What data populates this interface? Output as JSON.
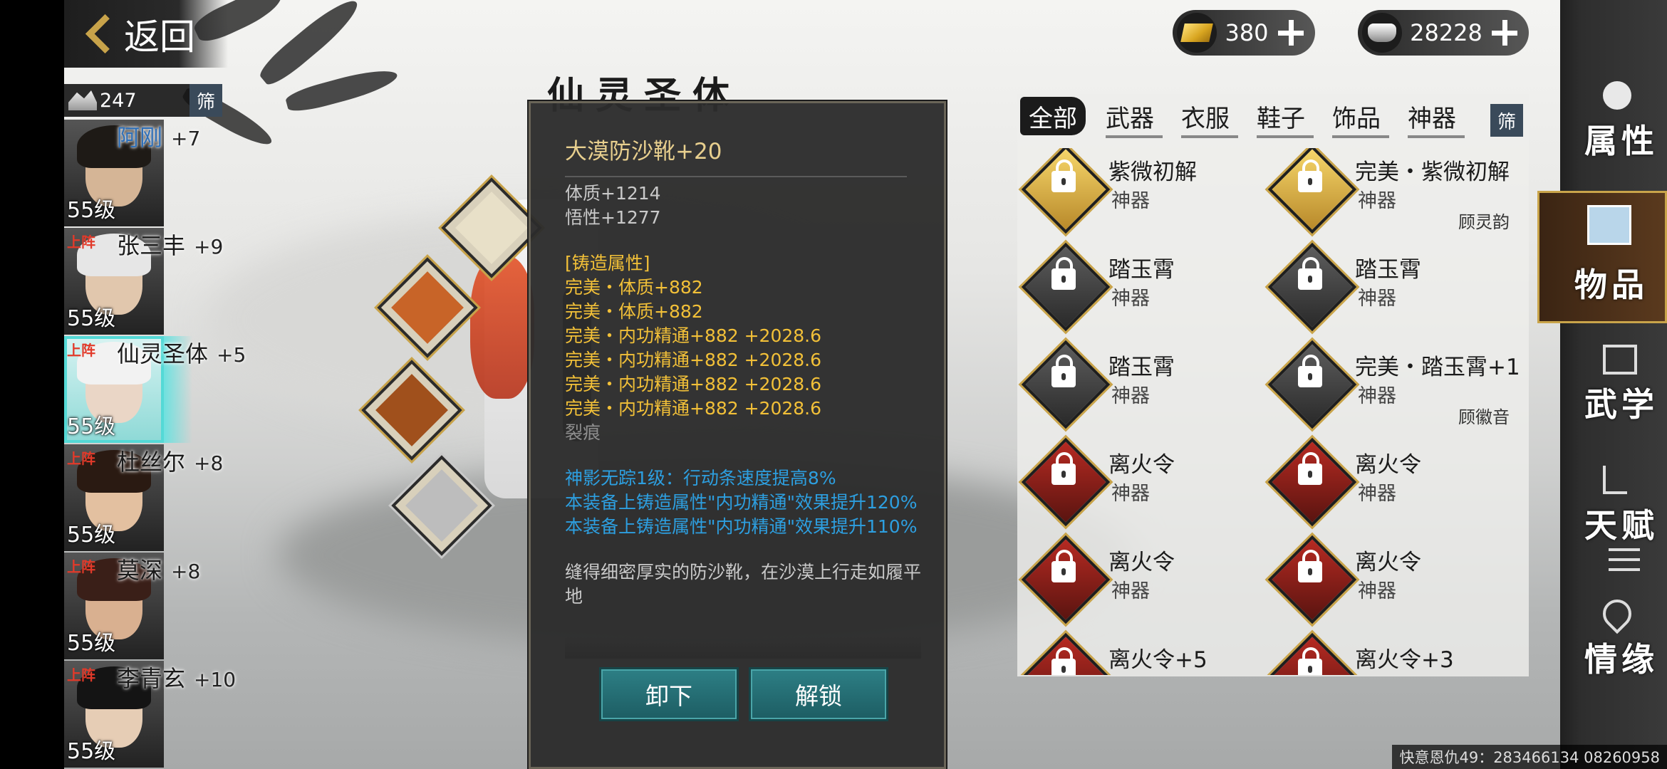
{
  "header": {
    "back_label": "返回",
    "gold": {
      "icon": "gold-ingot-icon",
      "value": "380"
    },
    "silver": {
      "icon": "silver-ingot-icon",
      "value": "28228"
    }
  },
  "roster": {
    "count": "247",
    "filter_label": "筛",
    "heroes": [
      {
        "name": "阿刚",
        "plus": "+7",
        "level": "55级",
        "tag": ""
      },
      {
        "name": "张三丰",
        "plus": "+9",
        "level": "55级",
        "tag": "上阵"
      },
      {
        "name": "仙灵圣体",
        "plus": "+5",
        "level": "55级",
        "tag": "上阵"
      },
      {
        "name": "杜丝尔",
        "plus": "+8",
        "level": "55级",
        "tag": "上阵"
      },
      {
        "name": "莫深",
        "plus": "+8",
        "level": "55级",
        "tag": "上阵"
      },
      {
        "name": "李青玄",
        "plus": "+10",
        "level": "55级",
        "tag": "上阵"
      }
    ]
  },
  "character": {
    "name": "仙灵圣体"
  },
  "tooltip": {
    "title": "大漠防沙靴+20",
    "base_stats": [
      "体质+1214",
      "悟性+1277"
    ],
    "forge_header": "[铸造属性]",
    "forge_lines": [
      "完美・体质+882",
      "完美・体质+882",
      "完美・内功精通+882  +2028.6",
      "完美・内功精通+882  +2028.6",
      "完美・内功精通+882  +2028.6",
      "完美・内功精通+882  +2028.6"
    ],
    "crack": "裂痕",
    "effects": [
      "神影无踪1级：行动条速度提高8%",
      "本装备上铸造属性\"内功精通\"效果提升120%",
      "本装备上铸造属性\"内功精通\"效果提升110%"
    ],
    "description": "缝得细密厚实的防沙靴，在沙漠上行走如履平地",
    "unequip_label": "卸下",
    "unlock_label": "解锁"
  },
  "inventory": {
    "tabs": [
      "全部",
      "武器",
      "衣服",
      "鞋子",
      "饰品",
      "神器"
    ],
    "active_tab": "全部",
    "filter_label": "筛",
    "items": [
      {
        "name": "紫微初解",
        "type": "神器",
        "owner": "",
        "style": "gold"
      },
      {
        "name": "完美・紫微初解",
        "type": "神器",
        "owner": "顾灵韵",
        "style": "gold"
      },
      {
        "name": "踏玉霄",
        "type": "神器",
        "owner": "",
        "style": "gray"
      },
      {
        "name": "踏玉霄",
        "type": "神器",
        "owner": "",
        "style": "gray"
      },
      {
        "name": "踏玉霄",
        "type": "神器",
        "owner": "",
        "style": "gray"
      },
      {
        "name": "完美・踏玉霄+1",
        "type": "神器",
        "owner": "顾徽音",
        "style": "gray"
      },
      {
        "name": "离火令",
        "type": "神器",
        "owner": "",
        "style": "red"
      },
      {
        "name": "离火令",
        "type": "神器",
        "owner": "",
        "style": "red"
      },
      {
        "name": "离火令",
        "type": "神器",
        "owner": "",
        "style": "red"
      },
      {
        "name": "离火令",
        "type": "神器",
        "owner": "",
        "style": "red"
      },
      {
        "name": "离火令+5",
        "type": "神器",
        "owner": "",
        "style": "red"
      },
      {
        "name": "离火令+3",
        "type": "神器",
        "owner": "",
        "style": "red"
      }
    ]
  },
  "sidebar": {
    "items": [
      "属性",
      "物品",
      "武学",
      "天赋",
      "情缘"
    ],
    "active": "物品"
  },
  "footer": {
    "text": "快意恩仇49：283466134  08260958"
  },
  "colors": {
    "accent_gold": "#c8a34a",
    "forge_yellow": "#f2c038",
    "effect_blue": "#2d9fe0",
    "button_teal": "#2d7f85"
  }
}
